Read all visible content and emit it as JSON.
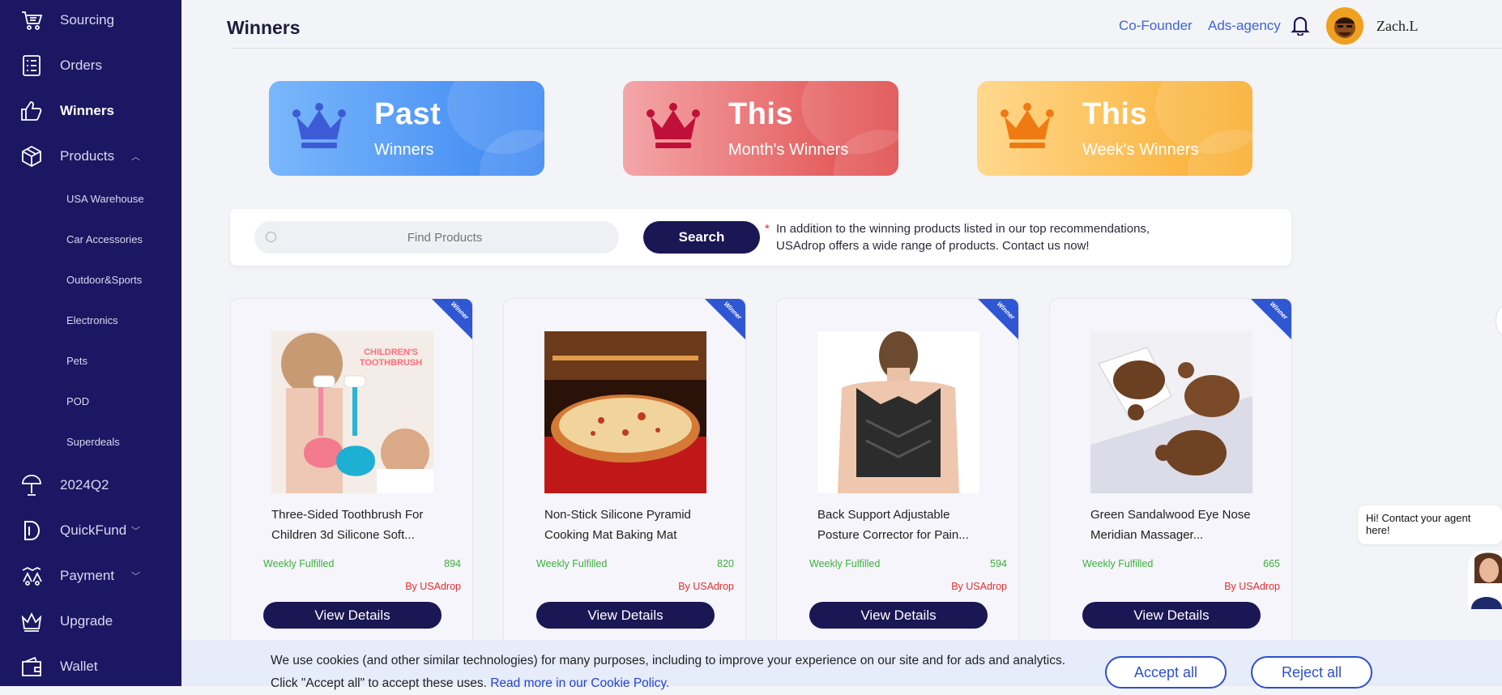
{
  "sidebar": {
    "items": [
      {
        "label": "Sourcing",
        "icon": "cart-icon"
      },
      {
        "label": "Orders",
        "icon": "orders-list-icon"
      },
      {
        "label": "Winners",
        "icon": "thumbs-up-icon"
      },
      {
        "label": "Products",
        "icon": "box-icon"
      },
      {
        "label": "2024Q2",
        "icon": "umbrella-icon"
      },
      {
        "label": "QuickFund",
        "icon": "quickfund-icon"
      },
      {
        "label": "Payment",
        "icon": "payment-icon"
      },
      {
        "label": "Upgrade",
        "icon": "crown-icon"
      },
      {
        "label": "Wallet",
        "icon": "wallet-icon"
      }
    ],
    "sub_items": [
      "USA Warehouse",
      "Car Accessories",
      "Outdoor&Sports",
      "Electronics",
      "Pets",
      "POD",
      "Superdeals"
    ]
  },
  "header": {
    "title": "Winners",
    "links": [
      "Co-Founder",
      "Ads-agency"
    ],
    "username": "Zach.L"
  },
  "banners": [
    {
      "big": "Past",
      "small": "Winners",
      "accent": "#3d5bd6"
    },
    {
      "big": "This",
      "small": "Month's Winners",
      "accent": "#c0103a"
    },
    {
      "big": "This",
      "small": "Week's Winners",
      "accent": "#f07a12"
    }
  ],
  "search": {
    "placeholder": "Find Products",
    "button": "Search",
    "note_star": "*",
    "note": "In addition to the winning products listed in our top recommendations, USAdrop offers a wide range of products. Contact us now!"
  },
  "products": [
    {
      "badge": "Winner",
      "title": "Three-Sided Toothbrush For Children 3d Silicone Soft...",
      "image_text": "CHILDREN'S TOOTHBRUSH",
      "weekly_label": "Weekly Fulfilled",
      "weekly_count": "894",
      "by": "By USAdrop",
      "button": "View Details"
    },
    {
      "badge": "Winner",
      "title": "Non-Stick Silicone Pyramid Cooking Mat Baking Mat",
      "weekly_label": "Weekly Fulfilled",
      "weekly_count": "820",
      "by": "By USAdrop",
      "button": "View Details"
    },
    {
      "badge": "Winner",
      "title": "Back Support Adjustable Posture Corrector for Pain...",
      "weekly_label": "Weekly Fulfilled",
      "weekly_count": "594",
      "by": "By USAdrop",
      "button": "View Details"
    },
    {
      "badge": "Winner",
      "title": "Green Sandalwood Eye Nose Meridian Massager...",
      "weekly_label": "Weekly Fulfilled",
      "weekly_count": "665",
      "by": "By USAdrop",
      "button": "View Details"
    }
  ],
  "chat": {
    "bubble": "Hi! Contact your agent here!"
  },
  "cookie": {
    "text": "We use cookies (and other similar technologies) for many purposes, including to improve your experience on our site and for ads and analytics. Click \"Accept all\" to accept these uses.",
    "link": "Read more in our Cookie Policy.",
    "accept": "Accept all",
    "reject": "Reject all"
  },
  "colors": {
    "sidebar": "#1b1763",
    "primary_button": "#1b1654",
    "link": "#3f64d6",
    "winner_ribbon": "#2f56d3",
    "weekly_green": "#3fae3f",
    "by_red": "#e03030"
  }
}
